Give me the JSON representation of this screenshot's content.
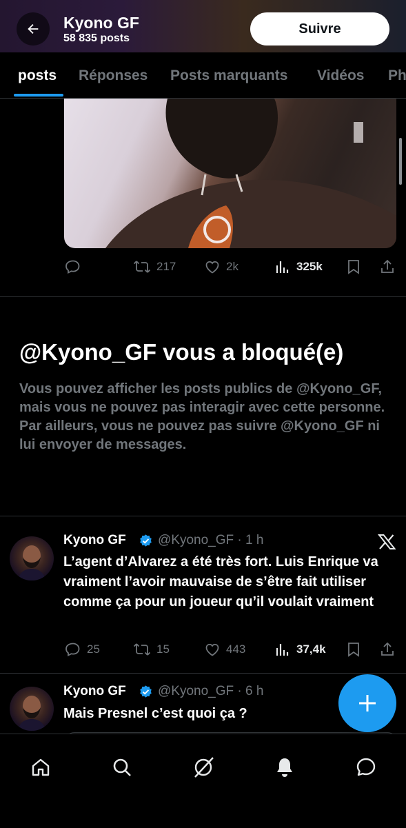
{
  "header": {
    "name": "Kyono GF",
    "posts_count": "58 835 posts",
    "follow_label": "Suivre"
  },
  "tabs": [
    {
      "label": "posts",
      "active": true
    },
    {
      "label": "Réponses"
    },
    {
      "label": "Posts marquants"
    },
    {
      "label": "Vidéos"
    },
    {
      "label": "Ph"
    }
  ],
  "post_top": {
    "retweets": "217",
    "likes": "2k",
    "views": "325k"
  },
  "blocked": {
    "title": "@Kyono_GF vous a bloqué(e)",
    "body": "Vous pouvez afficher les posts publics de @Kyono_GF, mais vous ne pouvez pas interagir avec cette personne. Par ailleurs, vous ne pouvez pas suivre @Kyono_GF ni lui envoyer de messages."
  },
  "tweets": [
    {
      "name": "Kyono GF",
      "handle_time": "@Kyono_GF · 1 h",
      "text": "L’agent d’Alvarez a été très fort. Luis Enrique va vraiment l’avoir mauvaise de s’être fait utiliser comme ça pour un joueur qu’il voulait vraiment",
      "replies": "25",
      "retweets": "15",
      "likes": "443",
      "views": "37,4k"
    },
    {
      "name": "Kyono GF",
      "handle_time": "@Kyono_GF · 6 h",
      "text": "Mais Presnel c’est quoi ça ?"
    }
  ],
  "colors": {
    "accent": "#1d9bf0",
    "muted": "#71767b",
    "background": "#000000"
  },
  "icons": {
    "back": "arrow-left-icon",
    "verified": "verified-badge-icon",
    "x_logo": "x-logo-icon",
    "fab": "plus-icon",
    "nav": [
      "home-icon",
      "search-icon",
      "grok-icon",
      "bell-icon",
      "messages-icon"
    ]
  }
}
